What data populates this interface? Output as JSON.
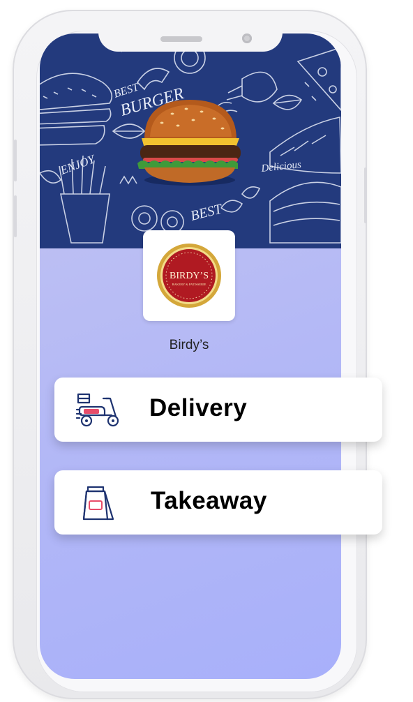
{
  "store": {
    "name": "Birdy’s",
    "logo_text": "BIRDY’S",
    "logo_subtext": "BAKERY & PATISSERIE"
  },
  "banner": {
    "words": [
      "BEST",
      "BURGER",
      "ENJOY",
      "Delicious",
      "BEST"
    ]
  },
  "options": [
    {
      "label": "Delivery",
      "icon": "scooter-icon"
    },
    {
      "label": "Takeaway",
      "icon": "takeaway-bag-icon"
    }
  ],
  "colors": {
    "banner_bg": "#233a7d",
    "screen_bg": "#b3b8f6",
    "logo_red": "#b01a22",
    "logo_gold": "#d4a73a",
    "icon_navy": "#1e3370",
    "icon_pink": "#e84d6a"
  }
}
